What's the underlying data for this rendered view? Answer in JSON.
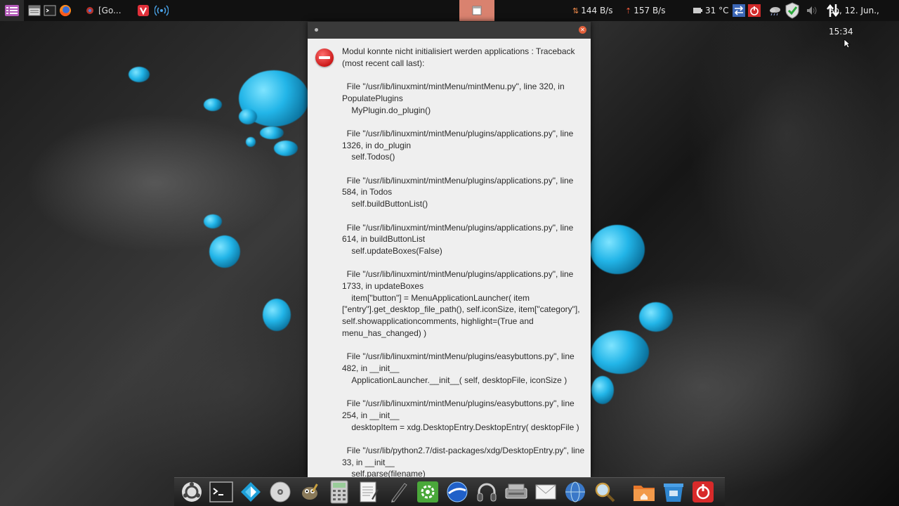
{
  "top_panel": {
    "window_task_label": "[Go...",
    "net_down": "144 B/s",
    "net_up": "157 B/s",
    "temperature": "31 °C",
    "clock": "So, 12. Jun., 15:34"
  },
  "dialog": {
    "message": "Modul konnte nicht initialisiert werden applications : Traceback (most recent call last):\n\n  File \"/usr/lib/linuxmint/mintMenu/mintMenu.py\", line 320, in PopulatePlugins\n    MyPlugin.do_plugin()\n\n  File \"/usr/lib/linuxmint/mintMenu/plugins/applications.py\", line 1326, in do_plugin\n    self.Todos()\n\n  File \"/usr/lib/linuxmint/mintMenu/plugins/applications.py\", line 584, in Todos\n    self.buildButtonList()\n\n  File \"/usr/lib/linuxmint/mintMenu/plugins/applications.py\", line 614, in buildButtonList\n    self.updateBoxes(False)\n\n  File \"/usr/lib/linuxmint/mintMenu/plugins/applications.py\", line 1733, in updateBoxes\n    item[\"button\"] = MenuApplicationLauncher( item [\"entry\"].get_desktop_file_path(), self.iconSize, item[\"category\"], self.showapplicationcomments, highlight=(True and menu_has_changed) )\n\n  File \"/usr/lib/linuxmint/mintMenu/plugins/easybuttons.py\", line 482, in __init__\n    ApplicationLauncher.__init__( self, desktopFile, iconSize )\n\n  File \"/usr/lib/linuxmint/mintMenu/plugins/easybuttons.py\", line 254, in __init__\n    desktopItem = xdg.DesktopEntry.DesktopEntry( desktopFile )\n\n  File \"/usr/lib/python2.7/dist-packages/xdg/DesktopEntry.py\", line 33, in __init__\n    self.parse(filename)"
  },
  "icons": {
    "top_panel": [
      "menu-icon",
      "file-manager-icon",
      "terminal-icon",
      "firefox-icon",
      "chrome-icon",
      "vivaldi-icon",
      "network-broadcast-icon",
      "window-icon",
      "net-speed-icon",
      "battery-icon",
      "swap-icon",
      "power-icon",
      "weather-icon",
      "shield-icon",
      "volume-icon",
      "network-updown-icon"
    ],
    "dock": [
      "ubuntu-icon",
      "terminal-icon",
      "kodi-icon",
      "disc-burner-icon",
      "gimp-icon",
      "calculator-icon",
      "text-editor-icon",
      "pen-icon",
      "settings-icon",
      "google-earth-icon",
      "headphones-icon",
      "scanner-icon",
      "mail-icon",
      "network-globe-icon",
      "search-icon",
      "home-folder-icon",
      "trash-icon",
      "shutdown-icon"
    ]
  },
  "colors": {
    "panel_bg": "#111111",
    "active_window": "#d9826f",
    "dialog_bg": "#efefef",
    "error_red": "#c81414",
    "accent_cyan": "#22b5e8"
  }
}
